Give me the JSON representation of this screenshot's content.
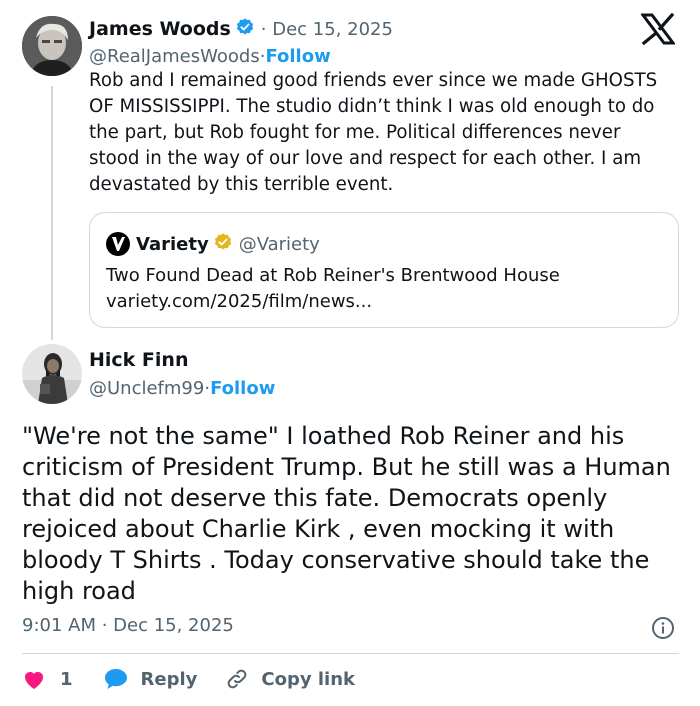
{
  "brand": {
    "logo_icon": "x-logo-icon",
    "accent": "#1d9bf0",
    "like_color": "#f91880",
    "verified_blue": "#1d9bf0",
    "verified_gold": "#e2b719"
  },
  "parent_tweet": {
    "author_name": "James Woods",
    "date": "· Dec 15, 2025",
    "handle": "@RealJamesWoods",
    "separator": " · ",
    "follow_label": "Follow",
    "text": "Rob and I remained good friends ever since we made GHOSTS OF MISSISSIPPI. The studio didn’t think I was old enough to do the part, but Rob fought for me. Political differences never stood in the way of our love and respect for each other. I am devastated by this terrible event."
  },
  "quoted_tweet": {
    "author_name": "Variety",
    "handle": "@Variety",
    "title": "Two Found Dead at Rob Reiner's Brentwood House",
    "url": "variety.com/2025/film/news..."
  },
  "main_tweet": {
    "author_name": "Hick Finn",
    "handle": "@Unclefm99",
    "separator": " · ",
    "follow_label": "Follow",
    "text": "\"We're not the same\" I loathed Rob Reiner and his criticism of President Trump. But he still was a Human that did not deserve this fate. Democrats openly rejoiced about Charlie Kirk , even mocking it with bloody T Shirts . Today conservative should take the high road",
    "timestamp": "9:01 AM · Dec 15, 2025"
  },
  "actions": {
    "like_count": "1",
    "reply_label": "Reply",
    "copy_label": "Copy link"
  }
}
